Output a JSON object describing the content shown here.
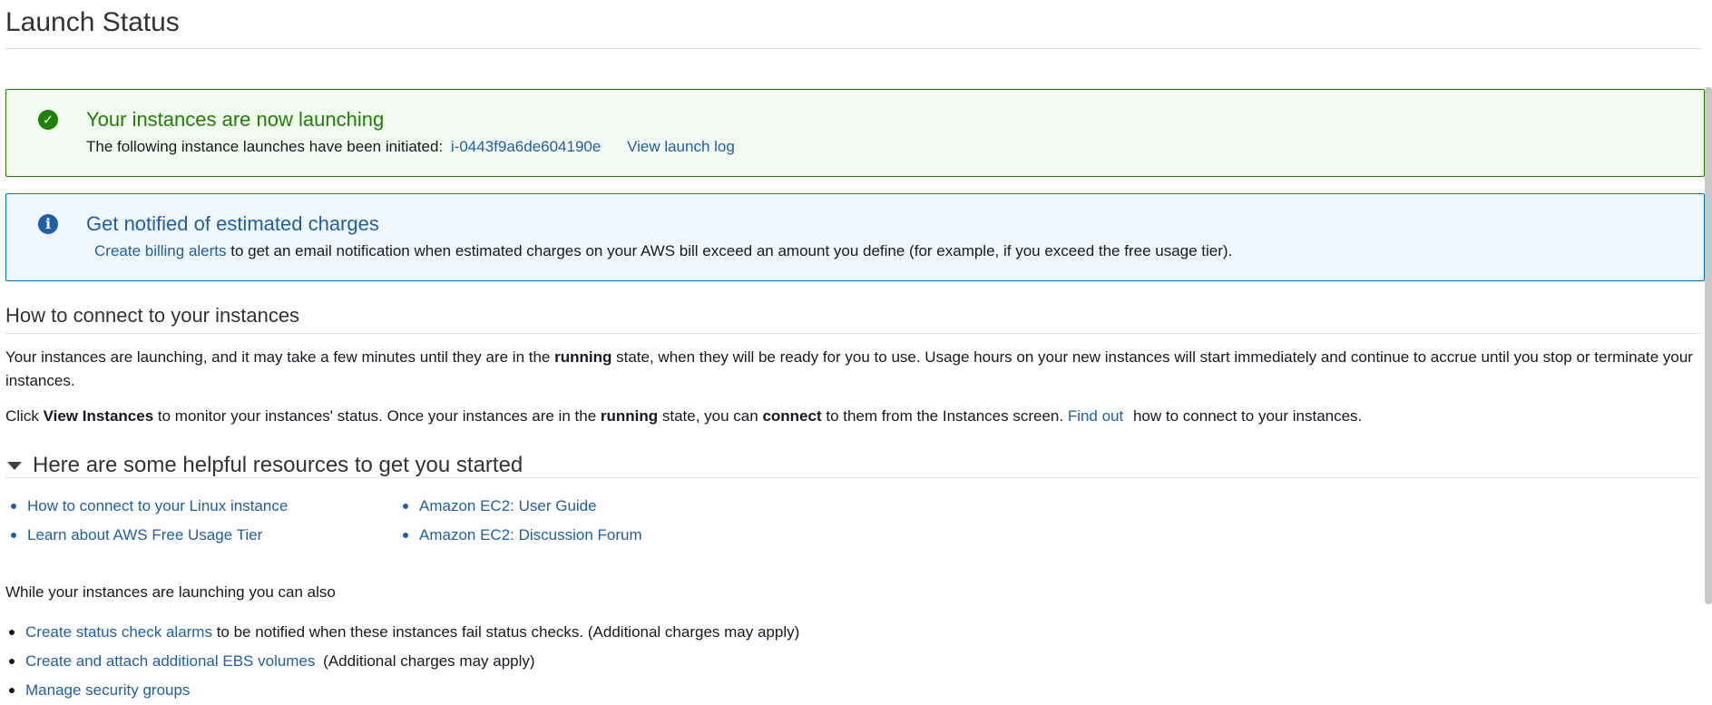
{
  "page": {
    "title": "Launch Status"
  },
  "success_alert": {
    "heading": "Your instances are now launching",
    "body_text": "The following instance launches have been initiated:",
    "instance_id": "i-0443f9a6de604190e",
    "view_log_link": "View launch log",
    "icon": "check-circle-icon",
    "color": "#1d8102"
  },
  "info_alert": {
    "heading": "Get notified of estimated charges",
    "link": "Create billing alerts",
    "body_text": "to get an email notification when estimated charges on your AWS bill exceed an amount you define (for example, if you exceed the free usage tier).",
    "icon": "info-circle-icon",
    "color": "#1f5fa8"
  },
  "connect_section": {
    "title": "How to connect to your instances",
    "para1": {
      "before": "Your instances are launching, and it may take a few minutes until they are in the ",
      "bold": "running",
      "after": " state, when they will be ready for you to use. Usage hours on your new instances will start immediately and continue to accrue until you stop or terminate your instances."
    },
    "para2": {
      "t1": "Click ",
      "b1": "View Instances",
      "t2": " to monitor your instances' status. Once your instances are in the ",
      "b2": "running",
      "t3": " state, you can ",
      "b3": "connect",
      "t4": " to them from the Instances screen. ",
      "link": "Find out",
      "t5": " how to connect to your instances."
    }
  },
  "resources": {
    "title": "Here are some helpful resources to get you started",
    "left": [
      "How to connect to your Linux instance",
      "Learn about AWS Free Usage Tier"
    ],
    "right": [
      "Amazon EC2: User Guide",
      "Amazon EC2: Discussion Forum"
    ]
  },
  "also": {
    "title": "While your instances are launching you can also",
    "items": [
      {
        "link": "Create status check alarms",
        "text": "to be notified when these instances fail status checks. (Additional charges may apply)"
      },
      {
        "link": "Create and attach additional EBS volumes",
        "text": "(Additional charges may apply)"
      },
      {
        "link": "Manage security groups",
        "text": ""
      }
    ]
  }
}
